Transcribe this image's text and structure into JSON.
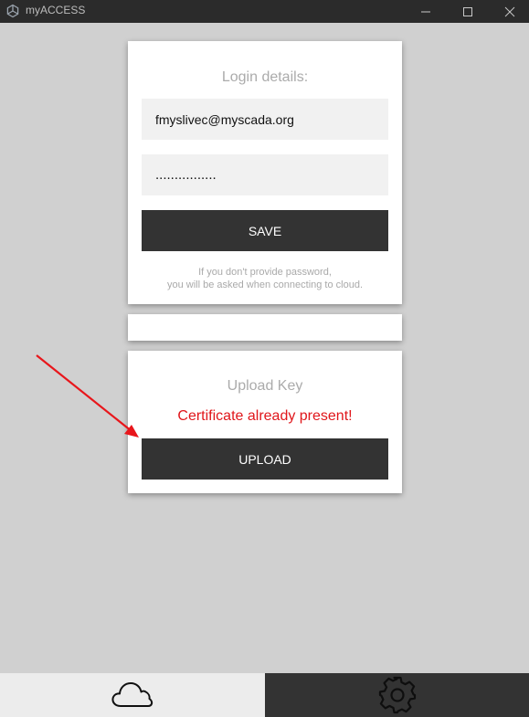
{
  "window": {
    "title": "myACCESS",
    "controls": [
      "minimize",
      "maximize",
      "close"
    ]
  },
  "login_card": {
    "title": "Login details:",
    "email_value": "fmyslivec@myscada.org",
    "password_value": "................",
    "save_label": "SAVE",
    "note_line1": "If you don't provide password,",
    "note_line2": "you will be asked when connecting to cloud."
  },
  "upload_card": {
    "title": "Upload Key",
    "status": "Certificate already present!",
    "upload_label": "UPLOAD"
  },
  "bottom_tabs": [
    {
      "icon": "cloud-icon",
      "active": true
    },
    {
      "icon": "gear-icon",
      "active": false
    }
  ],
  "colors": {
    "background": "#d0d0d0",
    "titlebar": "#2b2b2b",
    "button": "#333333",
    "status_red": "#e0161b",
    "annotation_arrow": "#e8161b",
    "tab_active": "#ececec",
    "tab_inactive": "#333333"
  }
}
